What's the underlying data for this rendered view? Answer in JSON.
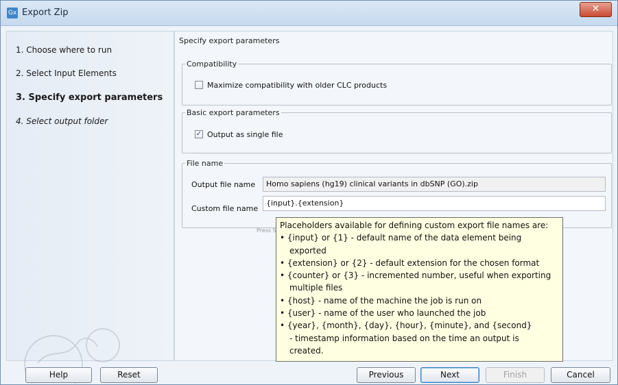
{
  "window": {
    "title": "Export Zip",
    "app_icon": "Gx",
    "close_symbol": "✕"
  },
  "steps": [
    {
      "label": "1.  Choose where to run"
    },
    {
      "label": "2.  Select Input Elements"
    },
    {
      "label": "3.  Specify export parameters"
    },
    {
      "label": "4.  Select output folder"
    }
  ],
  "content": {
    "title": "Specify export parameters",
    "compatibility": {
      "legend": "Compatibility",
      "checkbox_label": "Maximize compatibility with older CLC products",
      "checked": false
    },
    "basic": {
      "legend": "Basic export parameters",
      "checkbox_label": "Output as single file",
      "checked": true
    },
    "filename": {
      "legend": "File name",
      "output_label": "Output file name",
      "output_value": "Homo sapiens (hg19) clinical variants in dbSNP (GO).zip",
      "custom_label": "Custom file name",
      "custom_value": "{input}.{extension}",
      "hint": "Press Shift + F1 for options"
    }
  },
  "tooltip": {
    "lines": [
      "Placeholders available for defining custom export file names are:",
      "• {input} or {1} - default name of the data element being",
      "exported",
      "• {extension} or {2} - default extension for the chosen format",
      "• {counter} or {3} - incremented number, useful when exporting",
      "multiple files",
      "• {host} - name of the machine the job is run on",
      "• {user} - name of the user who launched the job",
      "• {year}, {month}, {day}, {hour}, {minute}, and {second}",
      "- timestamp information based on the time an output is",
      "created."
    ]
  },
  "buttons": {
    "help": "Help",
    "reset": "Reset",
    "previous": "Previous",
    "next": "Next",
    "finish": "Finish",
    "cancel": "Cancel"
  }
}
